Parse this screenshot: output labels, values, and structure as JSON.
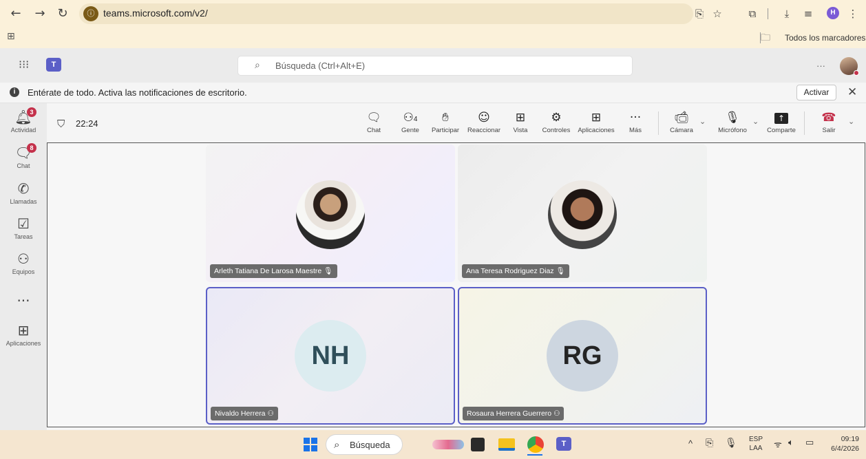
{
  "browser": {
    "url": "teams.microsoft.com/v2/",
    "profile_initial": "H",
    "bookmarks_label": "Todos los marcadores"
  },
  "teams": {
    "search_placeholder": "Búsqueda (Ctrl+Alt+E)",
    "more": "···"
  },
  "notification": {
    "text": "Entérate de todo. Activa las notificaciones de escritorio.",
    "button": "Activar"
  },
  "rail": [
    {
      "label": "Actividad",
      "icon": "bell-icon",
      "badge": "3"
    },
    {
      "label": "Chat",
      "icon": "chat-icon",
      "badge": "8"
    },
    {
      "label": "Llamadas",
      "icon": "phone-icon"
    },
    {
      "label": "Tareas",
      "icon": "tasks-icon"
    },
    {
      "label": "Equipos",
      "icon": "teams-icon"
    },
    {
      "label": "",
      "icon": "more-icon"
    },
    {
      "label": "Aplicaciones",
      "icon": "add-apps-icon"
    }
  ],
  "meeting": {
    "timer": "22:24",
    "toolbar": [
      {
        "label": "Chat"
      },
      {
        "label": "Gente",
        "count": "4"
      },
      {
        "label": "Participar"
      },
      {
        "label": "Reaccionar"
      },
      {
        "label": "Vista"
      },
      {
        "label": "Controles"
      },
      {
        "label": "Aplicaciones"
      },
      {
        "label": "Más"
      },
      {
        "label": "Cámara"
      },
      {
        "label": "Micrófono"
      },
      {
        "label": "Comparte"
      },
      {
        "label": "Salir"
      }
    ],
    "participants": [
      {
        "name": "Arleth Tatiana De Larosa Maestre",
        "status": "muted"
      },
      {
        "name": "Ana Teresa Rodriguez Diaz",
        "status": "muted"
      },
      {
        "name": "Nivaldo Herrera",
        "initials": "NH",
        "status": "guest"
      },
      {
        "name": "Rosaura Herrera Guerrero",
        "initials": "RG",
        "status": "guest"
      }
    ]
  },
  "taskbar": {
    "search": "Búsqueda",
    "lang_top": "ESP",
    "lang_bottom": "LAA",
    "time": "09:19",
    "date": "6/4/2026"
  }
}
